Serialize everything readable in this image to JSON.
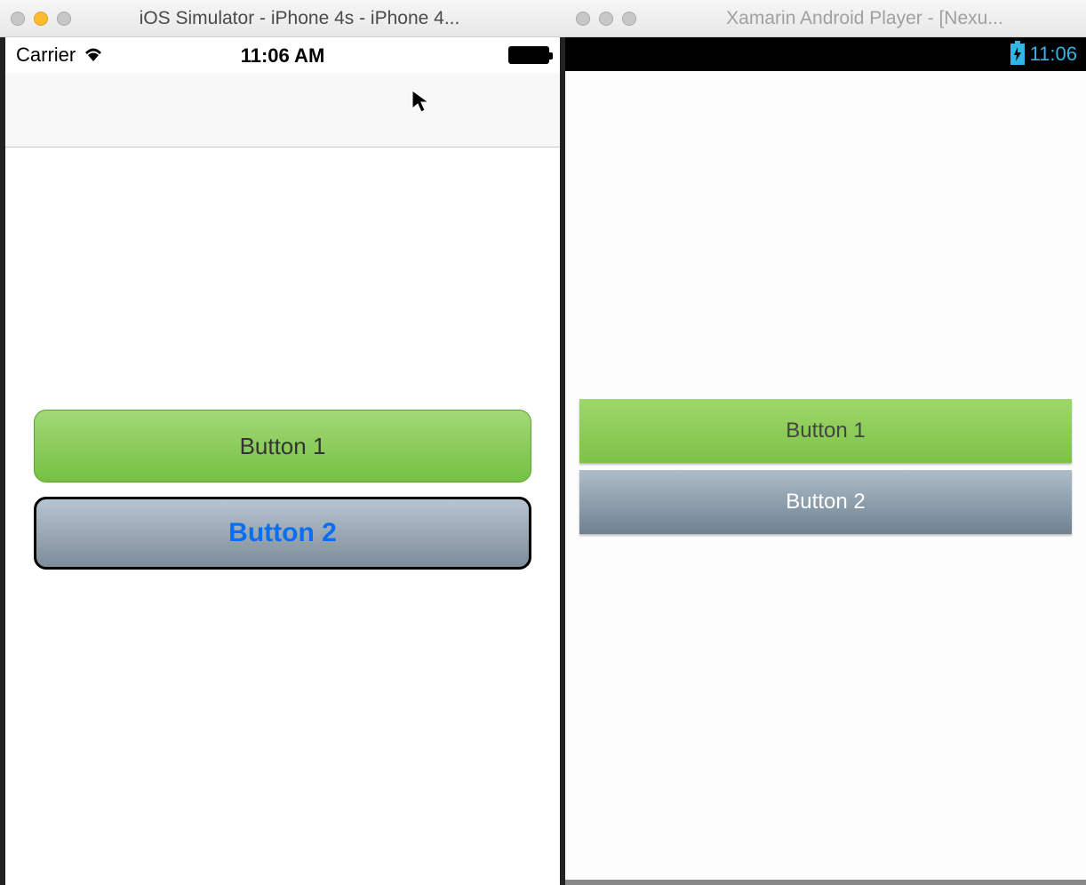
{
  "ios_window": {
    "title": "iOS Simulator - iPhone 4s - iPhone 4...",
    "statusbar": {
      "carrier": "Carrier",
      "time": "11:06 AM"
    },
    "buttons": {
      "button1_label": "Button 1",
      "button2_label": "Button 2"
    }
  },
  "android_window": {
    "title": "Xamarin Android Player - [Nexu...",
    "statusbar": {
      "time": "11:06"
    },
    "buttons": {
      "button1_label": "Button 1",
      "button2_label": "Button 2"
    }
  },
  "colors": {
    "green_top": "#a3d877",
    "green_bottom": "#75c043",
    "grey_top": "#b7c4d1",
    "grey_bottom": "#7d8c9a",
    "ios_button2_text": "#0a6ef0",
    "android_accent": "#33b5e5"
  }
}
